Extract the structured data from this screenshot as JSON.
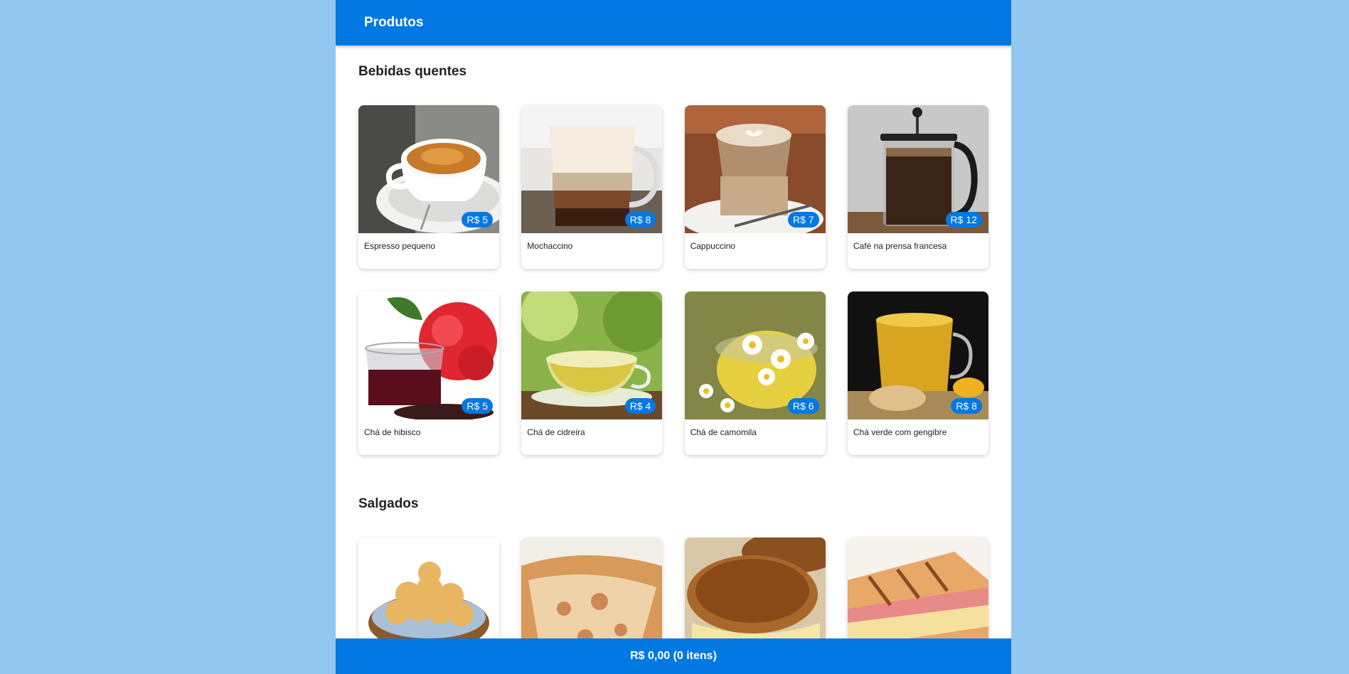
{
  "topbar": {
    "title": "Produtos"
  },
  "sections": [
    {
      "title": "Bebidas quentes",
      "products": [
        {
          "name": "Espresso pequeno",
          "price": "R$ 5",
          "icon": "espresso-icon"
        },
        {
          "name": "Mochaccino",
          "price": "R$ 8",
          "icon": "mochaccino-icon"
        },
        {
          "name": "Cappuccino",
          "price": "R$ 7",
          "icon": "cappuccino-icon"
        },
        {
          "name": "Café na prensa francesa",
          "price": "R$ 12",
          "icon": "french-press-icon"
        },
        {
          "name": "Chá de hibisco",
          "price": "R$ 5",
          "icon": "hibiscus-tea-icon"
        },
        {
          "name": "Chá de cidreira",
          "price": "R$ 4",
          "icon": "lemongrass-tea-icon"
        },
        {
          "name": "Chá de camomila",
          "price": "R$ 6",
          "icon": "chamomile-tea-icon"
        },
        {
          "name": "Chá verde com gengibre",
          "price": "R$ 8",
          "icon": "ginger-tea-icon"
        }
      ]
    },
    {
      "title": "Salgados",
      "products": [
        {
          "icon": "cheese-bread-icon"
        },
        {
          "icon": "pizza-slice-icon"
        },
        {
          "icon": "toasted-sandwich-icon"
        },
        {
          "icon": "ham-cheese-sandwich-icon"
        }
      ]
    }
  ],
  "cart": {
    "summary": "R$ 0,00 (0 itens)"
  },
  "colors": {
    "primary": "#0278e2",
    "background": "#93c7f0"
  }
}
